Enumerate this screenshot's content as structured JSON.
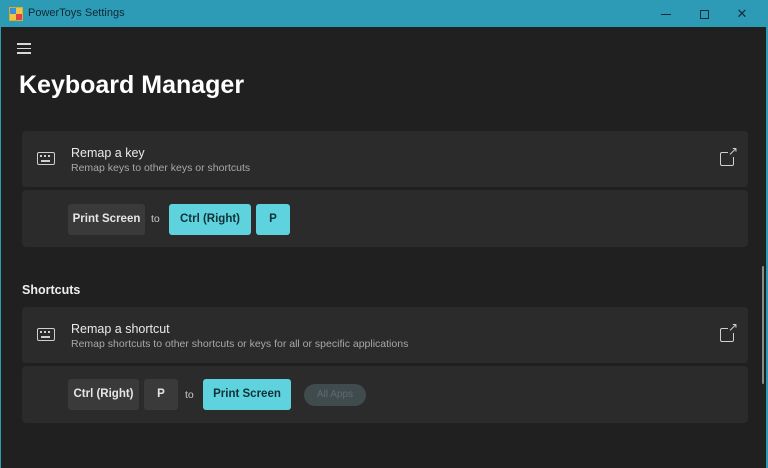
{
  "window": {
    "title": "PowerToys Settings"
  },
  "page": {
    "title": "Keyboard Manager"
  },
  "remap_key": {
    "title": "Remap a key",
    "description": "Remap keys to other keys or shortcuts",
    "mapping": {
      "from": [
        "Print Screen"
      ],
      "to_label": "to",
      "to": [
        "Ctrl (Right)",
        "P"
      ]
    }
  },
  "shortcuts": {
    "heading": "Shortcuts",
    "title": "Remap a shortcut",
    "description": "Remap shortcuts to other shortcuts or keys for all or specific applications",
    "mapping": {
      "from": [
        "Ctrl (Right)",
        "P"
      ],
      "to_label": "to",
      "to": [
        "Print Screen"
      ],
      "scope": "All Apps"
    }
  },
  "colors": {
    "accent": "#5fd3dd",
    "titlebar": "#2d9bb6",
    "background": "#202020",
    "card": "#2b2b2b"
  },
  "icons": {
    "keyboard": "keyboard-icon",
    "external": "open-external-icon",
    "menu": "hamburger-menu-icon"
  }
}
